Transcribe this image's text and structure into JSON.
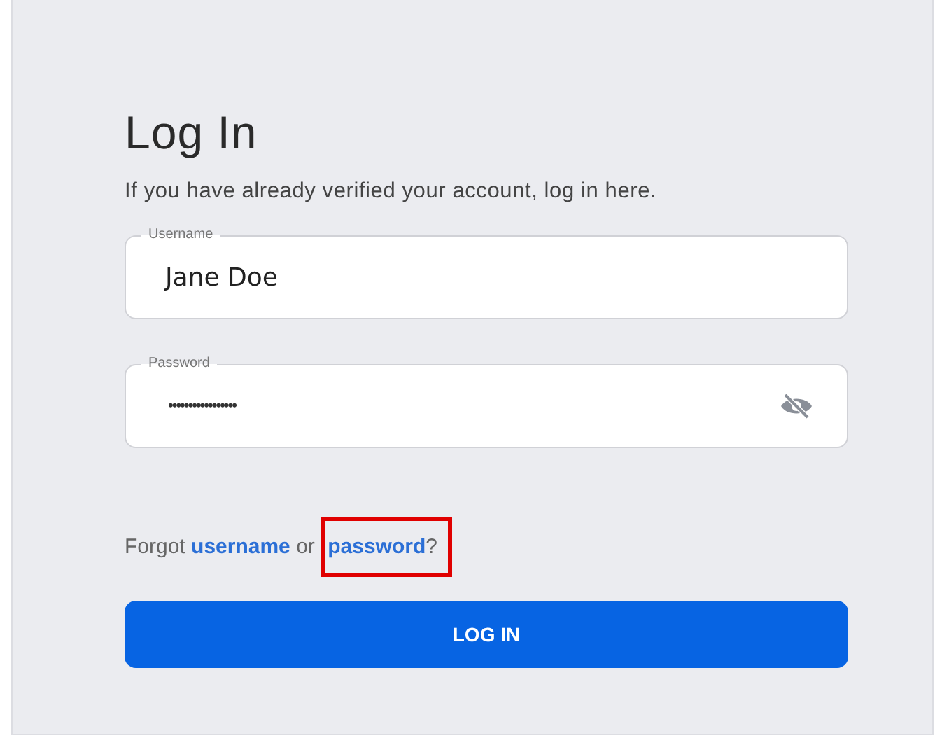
{
  "title": "Log In",
  "subtitle": "If you have already verified your account, log in here.",
  "fields": [
    {
      "kind": "text",
      "label": "Username",
      "value": "Jane Doe"
    },
    {
      "kind": "password",
      "label": "Password",
      "value": "•••••••••••••••••",
      "revealed": false
    }
  ],
  "forgot": [
    {
      "kind": "text",
      "text": "Forgot"
    },
    {
      "kind": "link",
      "text": "username"
    },
    {
      "kind": "text",
      "text": "or"
    },
    {
      "kind": "link",
      "text": "password",
      "highlighted": true
    },
    {
      "kind": "text",
      "text": "?",
      "highlighted": true
    }
  ],
  "button": "LOG IN"
}
